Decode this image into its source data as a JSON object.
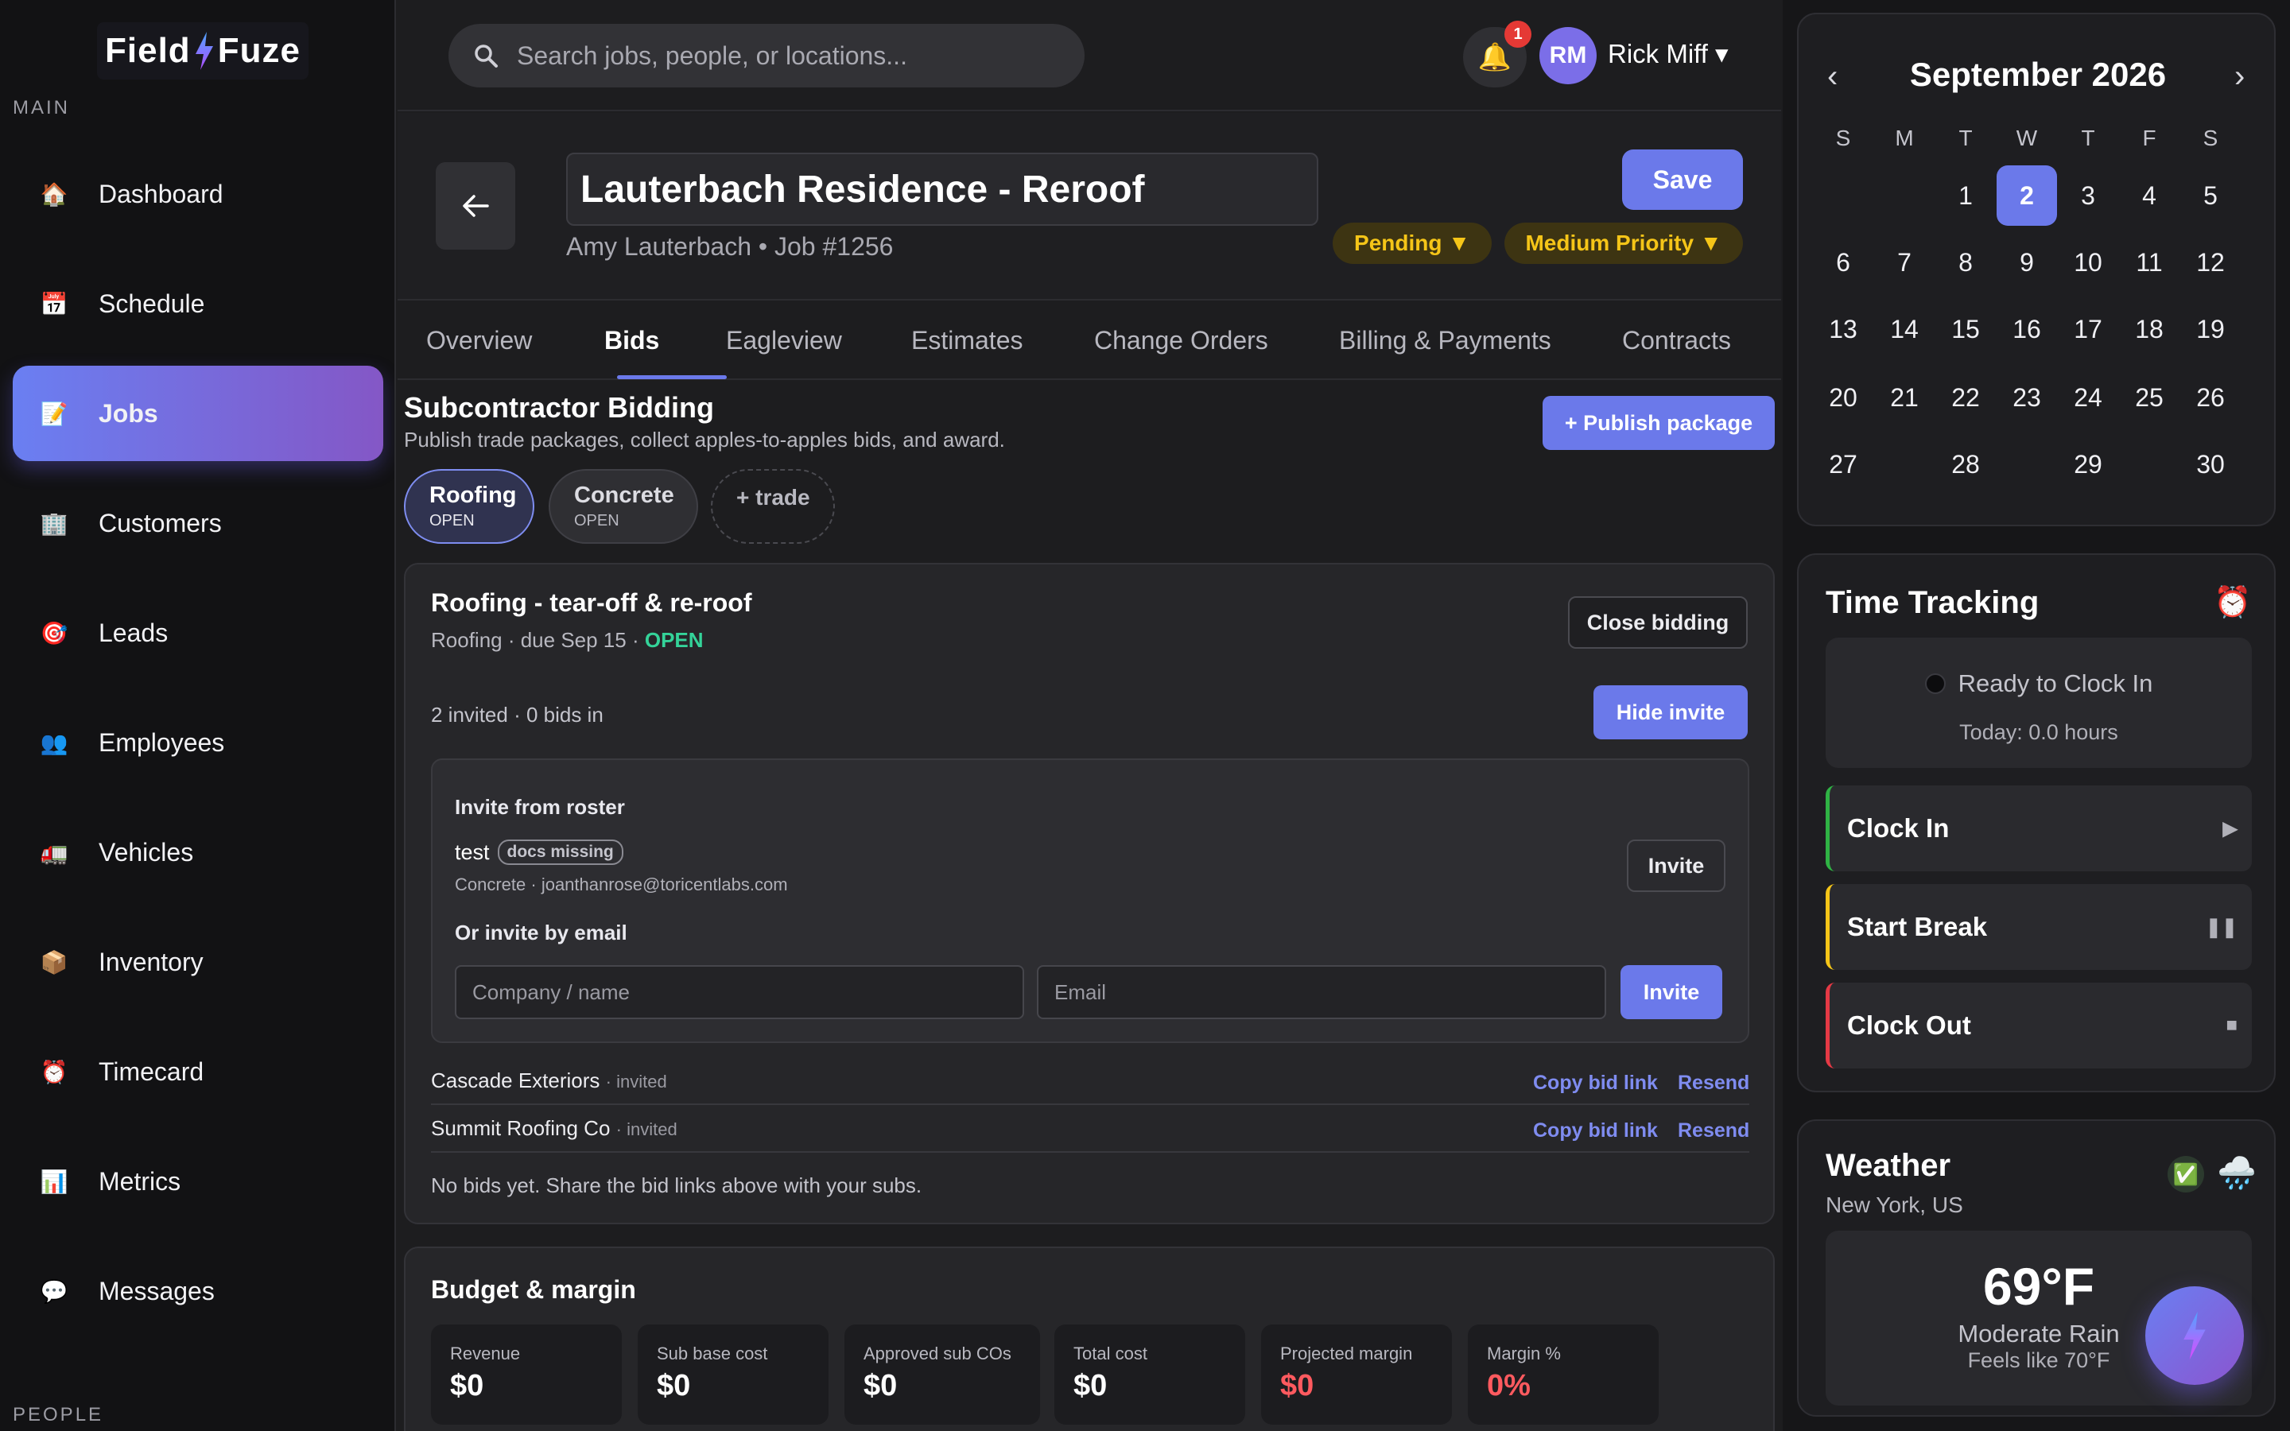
{
  "brand": {
    "logo_left": "Field",
    "logo_right": "Fuze",
    "accent": "#6b79ea"
  },
  "sidebar": {
    "section_main": "MAIN",
    "section_people": "PEOPLE",
    "items": [
      {
        "label": "Dashboard",
        "icon": "house-icon"
      },
      {
        "label": "Schedule",
        "icon": "calendar-icon"
      },
      {
        "label": "Jobs",
        "icon": "memo-icon",
        "active": true
      },
      {
        "label": "Customers",
        "icon": "office-building-icon"
      },
      {
        "label": "Leads",
        "icon": "target-icon"
      },
      {
        "label": "Employees",
        "icon": "people-icon"
      },
      {
        "label": "Vehicles",
        "icon": "truck-icon"
      },
      {
        "label": "Inventory",
        "icon": "package-icon"
      },
      {
        "label": "Timecard",
        "icon": "alarm-clock-icon"
      },
      {
        "label": "Metrics",
        "icon": "bar-chart-icon"
      },
      {
        "label": "Messages",
        "icon": "speech-bubble-icon"
      }
    ]
  },
  "topbar": {
    "search_placeholder": "Search jobs, people, or locations...",
    "notification_count": "1",
    "user_initials": "RM",
    "user_name": "Rick Miff ▾"
  },
  "job": {
    "title": "Lauterbach Residence - Reroof",
    "subtitle": "Amy Lauterbach • Job #1256",
    "save_label": "Save",
    "status": "Pending ▼",
    "priority": "Medium Priority ▼"
  },
  "tabs": [
    "Overview",
    "Bids",
    "Eagleview",
    "Estimates",
    "Change Orders",
    "Billing & Payments",
    "Contracts"
  ],
  "active_tab": "Bids",
  "bidding": {
    "title": "Subcontractor Bidding",
    "description": "Publish trade packages, collect apples-to-apples bids, and award.",
    "publish_label": "+ Publish package",
    "trades": [
      {
        "name": "Roofing",
        "status": "OPEN"
      },
      {
        "name": "Concrete",
        "status": "OPEN"
      }
    ],
    "add_trade_label": "+ trade",
    "package": {
      "title": "Roofing - tear-off & re-roof",
      "meta_prefix": "Roofing · due Sep 15 · ",
      "meta_status": "OPEN",
      "close_label": "Close bidding",
      "counts": "2 invited · 0 bids in",
      "hide_invite_label": "Hide invite",
      "roster_heading": "Invite from roster",
      "roster_name": "test",
      "roster_badge": "docs missing",
      "roster_detail": "Concrete · joanthanrose@toricentlabs.com",
      "roster_invite_label": "Invite",
      "email_heading": "Or invite by email",
      "company_placeholder": "Company / name",
      "email_placeholder": "Email",
      "email_invite_label": "Invite",
      "invited": [
        {
          "name": "Cascade Exteriors",
          "status": "· invited",
          "copy": "Copy bid link",
          "resend": "Resend"
        },
        {
          "name": "Summit Roofing Co",
          "status": "· invited",
          "copy": "Copy bid link",
          "resend": "Resend"
        }
      ],
      "empty_text": "No bids yet. Share the bid links above with your subs."
    }
  },
  "budget": {
    "title": "Budget & margin",
    "metrics": [
      {
        "label": "Revenue",
        "value": "$0"
      },
      {
        "label": "Sub base cost",
        "value": "$0"
      },
      {
        "label": "Approved sub COs",
        "value": "$0"
      },
      {
        "label": "Total cost",
        "value": "$0"
      },
      {
        "label": "Projected margin",
        "value": "$0"
      },
      {
        "label": "Margin %",
        "value": "0%"
      }
    ],
    "negative_color": "#ff5a5f"
  },
  "calendar": {
    "month": "September 2026",
    "weekdays": [
      "S",
      "M",
      "T",
      "W",
      "T",
      "F",
      "S"
    ],
    "selected_day": "2",
    "rows": [
      [
        "",
        "",
        "1",
        "2",
        "3",
        "4",
        "5"
      ],
      [
        "6",
        "7",
        "8",
        "9",
        "10",
        "11",
        "12"
      ],
      [
        "13",
        "14",
        "15",
        "16",
        "17",
        "18",
        "19"
      ],
      [
        "20",
        "21",
        "22",
        "23",
        "24",
        "25",
        "26"
      ],
      [
        "27",
        "28",
        "29",
        "30"
      ]
    ]
  },
  "time_tracking": {
    "title": "Time Tracking",
    "status": "Ready to Clock In",
    "today": "Today: 0.0 hours",
    "buttons": [
      {
        "label": "Clock In",
        "color": "#2fb344"
      },
      {
        "label": "Start Break",
        "color": "#f5c518"
      },
      {
        "label": "Clock Out",
        "color": "#e53945"
      }
    ]
  },
  "weather": {
    "title": "Weather",
    "location": "New York, US",
    "temp": "69°F",
    "condition": "Moderate Rain",
    "feels_like": "Feels like 70°F"
  }
}
